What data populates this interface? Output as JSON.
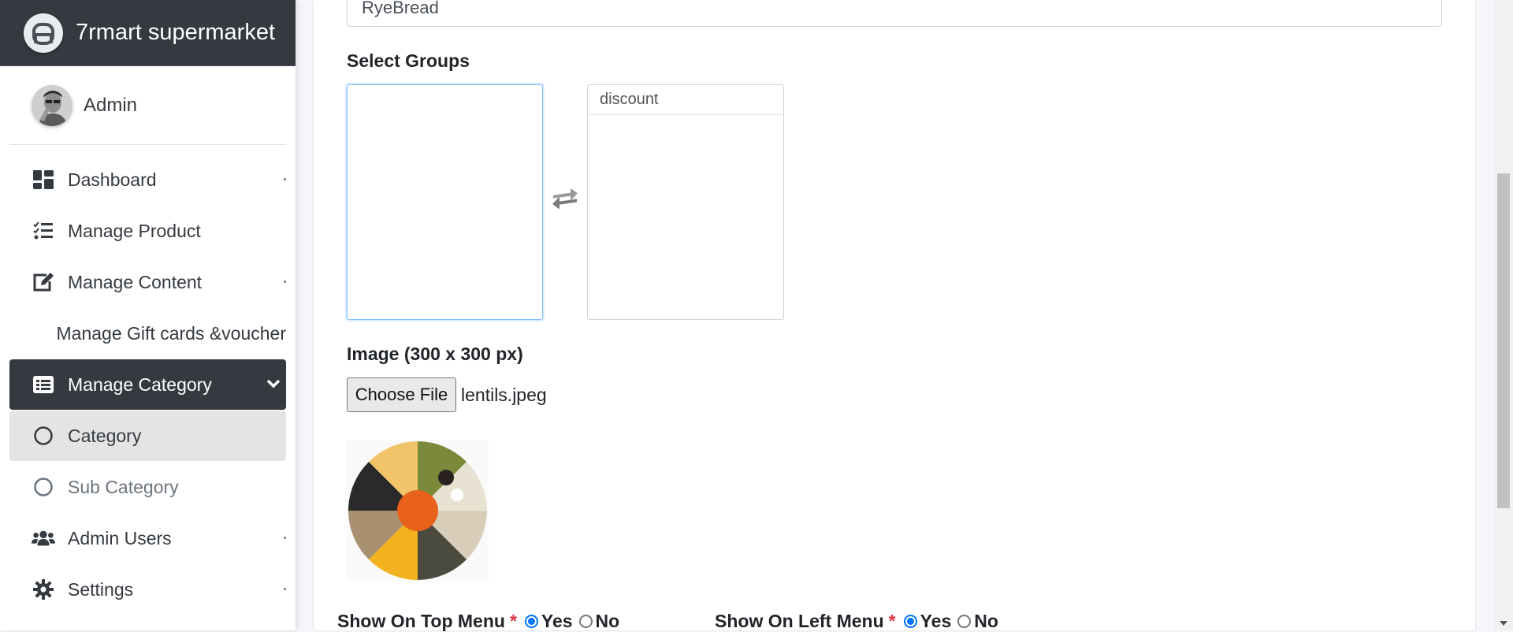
{
  "brand": {
    "name": "7rmart supermarket"
  },
  "user": {
    "name": "Admin"
  },
  "nav": {
    "dashboard": "Dashboard",
    "manage_product": "Manage Product",
    "manage_content": "Manage Content",
    "manage_gift": "Manage Gift cards &voucher",
    "manage_category": "Manage Category",
    "category": "Category",
    "sub_category": "Sub Category",
    "admin_users": "Admin Users",
    "settings": "Settings"
  },
  "form": {
    "name_value": "RyeBread",
    "select_groups_label": "Select Groups",
    "selected_groups": [
      "discount"
    ],
    "image_label": "Image (300 x 300 px)",
    "choose_file_label": "Choose File",
    "file_name": "lentils.jpeg",
    "top_menu": {
      "label": "Show On Top Menu",
      "required": "*",
      "yes": "Yes",
      "no": "No",
      "selected": "Yes"
    },
    "left_menu": {
      "label": "Show On Left Menu",
      "required": "*",
      "yes": "Yes",
      "no": "No",
      "selected": "Yes"
    }
  },
  "colors": {
    "sidebar_dark": "#343a40",
    "accent_blue": "#0075ff",
    "required_red": "#dc3545"
  }
}
